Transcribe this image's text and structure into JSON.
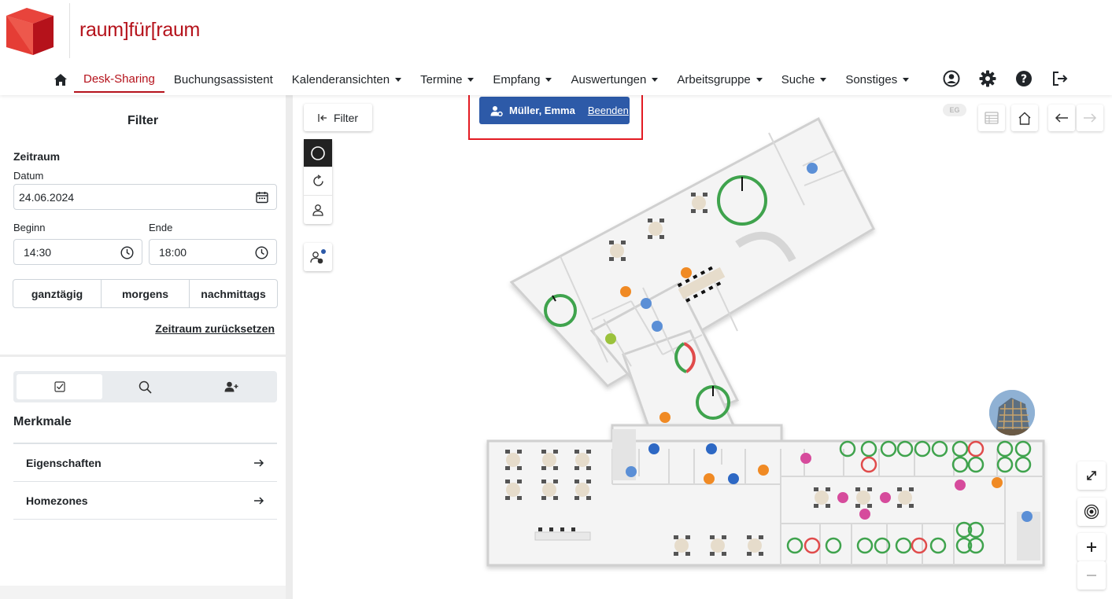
{
  "brand": {
    "logo_text": "raum]für[raum",
    "color": "#b5121b"
  },
  "nav": {
    "items": [
      {
        "label": "Desk-Sharing",
        "active": true,
        "dropdown": false
      },
      {
        "label": "Buchungsassistent",
        "dropdown": false
      },
      {
        "label": "Kalenderansichten",
        "dropdown": true
      },
      {
        "label": "Termine",
        "dropdown": true
      },
      {
        "label": "Empfang",
        "dropdown": true
      },
      {
        "label": "Auswertungen",
        "dropdown": true
      },
      {
        "label": "Arbeitsgruppe",
        "dropdown": true
      },
      {
        "label": "Suche",
        "dropdown": true
      },
      {
        "label": "Sonstiges",
        "dropdown": true
      }
    ],
    "icons": [
      "user-circle-icon",
      "gear-icon",
      "help-icon",
      "logout-icon"
    ]
  },
  "filter": {
    "title": "Filter",
    "zeitraum_title": "Zeitraum",
    "datum_label": "Datum",
    "datum_value": "24.06.2024",
    "beginn_label": "Beginn",
    "beginn_value": "14:30",
    "ende_label": "Ende",
    "ende_value": "18:00",
    "presets": [
      "ganztägig",
      "morgens",
      "nachmittags"
    ],
    "reset_label": "Zeitraum zurücksetzen"
  },
  "merkmale": {
    "title": "Merkmale",
    "items": [
      "Eigenschaften",
      "Homezones"
    ]
  },
  "map": {
    "filter_button": "Filter",
    "impersonation": {
      "name": "Müller, Emma",
      "end_label": "Beenden",
      "color": "#2d5aa8"
    },
    "floor": "EG"
  }
}
